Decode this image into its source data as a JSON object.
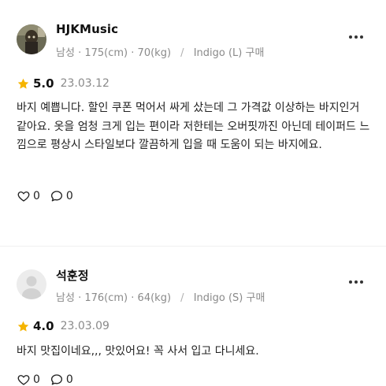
{
  "reviews": [
    {
      "username": "HJKMusic",
      "avatar_type": "photo",
      "meta": {
        "gender": "남성",
        "height": "175(cm)",
        "weight": "70(kg)",
        "option": "Indigo (L) 구매"
      },
      "dot": "·",
      "divider": "/",
      "rating": "5.0",
      "date": "23.03.12",
      "text": "바지 예쁩니다. 할인 쿠폰 먹어서 싸게 샀는데 그 가격값 이상하는 바지인거 같아요. 옷을 엄청 크게 입는 편이라 저한테는 오버핏까진 아닌데 테이퍼드 느낌으로 평상시 스타일보다 깔끔하게 입을 때 도움이 되는 바지에요.",
      "likes": "0",
      "comments": "0"
    },
    {
      "username": "석훈정",
      "avatar_type": "default",
      "meta": {
        "gender": "남성",
        "height": "176(cm)",
        "weight": "64(kg)",
        "option": "Indigo (S) 구매"
      },
      "dot": "·",
      "divider": "/",
      "rating": "4.0",
      "date": "23.03.09",
      "text": "바지 맛집이네요,,, 맛있어요! 꼭 사서 입고 다니세요.",
      "likes": "0",
      "comments": "0"
    }
  ],
  "icons": {
    "star": "star-icon",
    "more": "more-options-icon",
    "like": "heart-icon",
    "comment": "comment-icon"
  },
  "colors": {
    "star": "#f5b400",
    "meta": "#8a8a8a",
    "text": "#222222"
  }
}
